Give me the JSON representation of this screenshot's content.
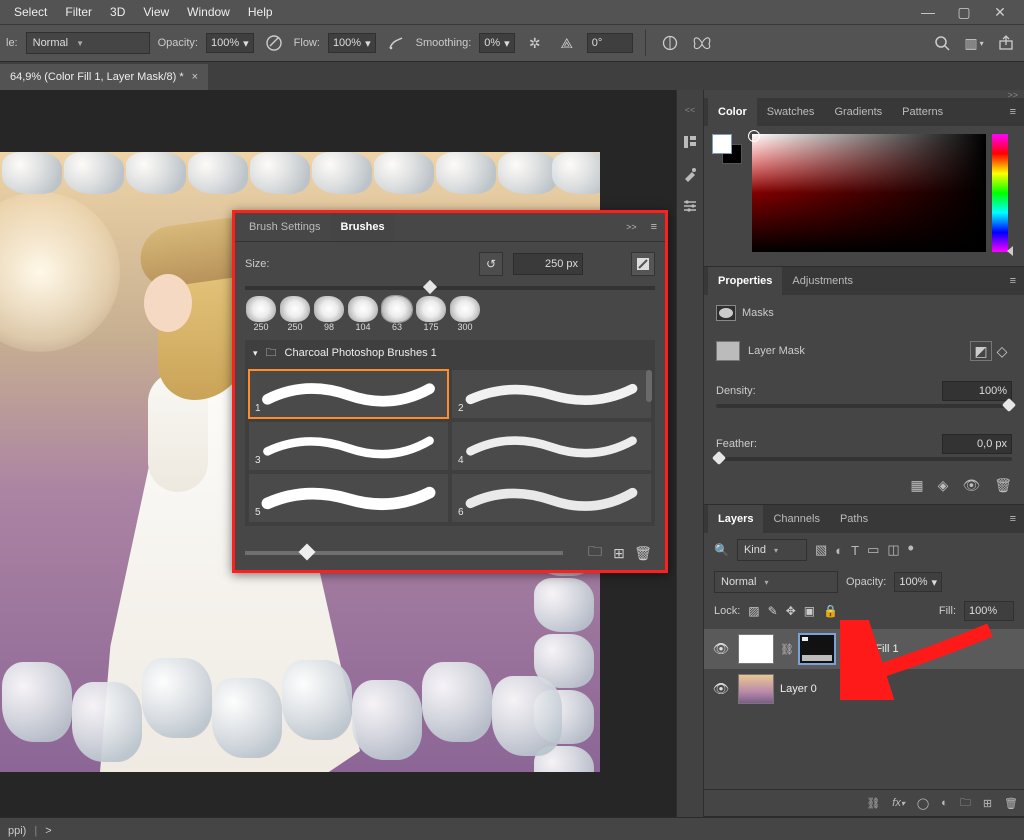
{
  "menu": {
    "items": [
      "Select",
      "Filter",
      "3D",
      "View",
      "Window",
      "Help"
    ]
  },
  "optbar": {
    "mode_label": "Normal",
    "opacity_label": "Opacity:",
    "opacity_value": "100%",
    "flow_label": "Flow:",
    "flow_value": "100%",
    "smooth_label": "Smoothing:",
    "smooth_value": "0%",
    "angle_value": "0°"
  },
  "doc": {
    "title": "64,9% (Color Fill 1, Layer Mask/8) *"
  },
  "color_panel": {
    "tabs": [
      "Color",
      "Swatches",
      "Gradients",
      "Patterns"
    ]
  },
  "properties_panel": {
    "tabs": [
      "Properties",
      "Adjustments"
    ],
    "masks_label": "Masks",
    "layermask_label": "Layer Mask",
    "density_label": "Density:",
    "density_value": "100%",
    "feather_label": "Feather:",
    "feather_value": "0,0 px"
  },
  "layers_panel": {
    "tabs": [
      "Layers",
      "Channels",
      "Paths"
    ],
    "kind_label": "Kind",
    "blend": "Normal",
    "opacity_label": "Opacity:",
    "opacity_value": "100%",
    "lock_label": "Lock:",
    "fill_label": "Fill:",
    "fill_value": "100%",
    "layers": [
      {
        "name": "Color Fill 1"
      },
      {
        "name": "Layer 0"
      }
    ]
  },
  "brush_panel": {
    "tabs": [
      "Brush Settings",
      "Brushes"
    ],
    "size_label": "Size:",
    "size_value": "250 px",
    "tips": [
      "250",
      "250",
      "98",
      "104",
      "63",
      "175",
      "300"
    ],
    "folder": "Charcoal Photoshop Brushes 1",
    "items": [
      "1",
      "2",
      "3",
      "4",
      "5",
      "6"
    ]
  },
  "status": {
    "text": "ppi)",
    "chev": ">"
  }
}
